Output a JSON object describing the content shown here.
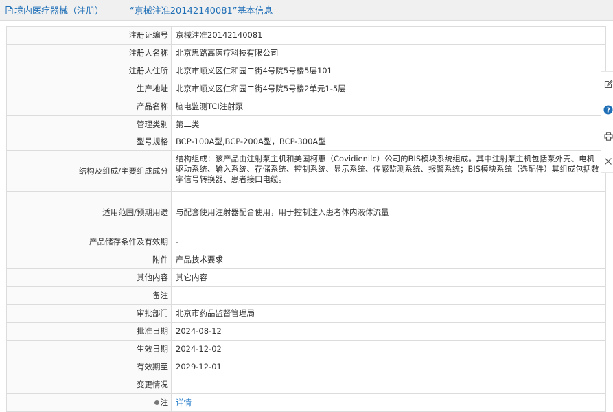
{
  "header": {
    "section": "境内医疗器械（注册）",
    "separator": "——",
    "title": "“京械注准20142140081”基本信息"
  },
  "rows": [
    {
      "label": "注册证编号",
      "value": "京械注准20142140081"
    },
    {
      "label": "注册人名称",
      "value": "北京思路高医疗科技有限公司"
    },
    {
      "label": "注册人住所",
      "value": "北京市顺义区仁和园二街4号院5号楼5层101"
    },
    {
      "label": "生产地址",
      "value": "北京市顺义区仁和园二街4号院5号楼2单元1-5层"
    },
    {
      "label": "产品名称",
      "value": "脑电监测TCI注射泵"
    },
    {
      "label": "管理类别",
      "value": "第二类"
    },
    {
      "label": "型号规格",
      "value": "BCP-100A型,BCP-200A型，BCP-300A型"
    },
    {
      "label": "结构及组成/主要组成成分",
      "value": "结构组成：该产品由注射泵主机和美国柯惠（Covidienllc）公司的BIS模块系统组成。其中注射泵主机包括泵外壳、电机驱动系统、输入系统、存储系统、控制系统、显示系统、传感监测系统、报警系统；BIS模块系统（选配件）其组成包括数字信号转换器、患者接口电缆。"
    },
    {
      "label": "适用范围/预期用途",
      "value": "与配套使用注射器配合使用，用于控制注入患者体内液体流量"
    },
    {
      "label": "产品储存条件及有效期",
      "value": "-"
    },
    {
      "label": "附件",
      "value": "产品技术要求"
    },
    {
      "label": "其他内容",
      "value": "其它内容"
    },
    {
      "label": "备注",
      "value": ""
    },
    {
      "label": "审批部门",
      "value": "北京市药品监督管理局"
    },
    {
      "label": "批准日期",
      "value": "2024-08-12"
    },
    {
      "label": "生效日期",
      "value": "2024-12-02"
    },
    {
      "label": "有效期至",
      "value": "2029-12-01"
    },
    {
      "label": "变更情况",
      "value": ""
    }
  ],
  "note": {
    "label": "注",
    "link_text": "详情"
  },
  "side_tools": [
    "edit-icon",
    "help-icon",
    "print-icon",
    "close-icon"
  ],
  "colors": {
    "link": "#1f78c8",
    "header_text": "#1f6fb7",
    "help_icon": "#1f6fb7"
  }
}
